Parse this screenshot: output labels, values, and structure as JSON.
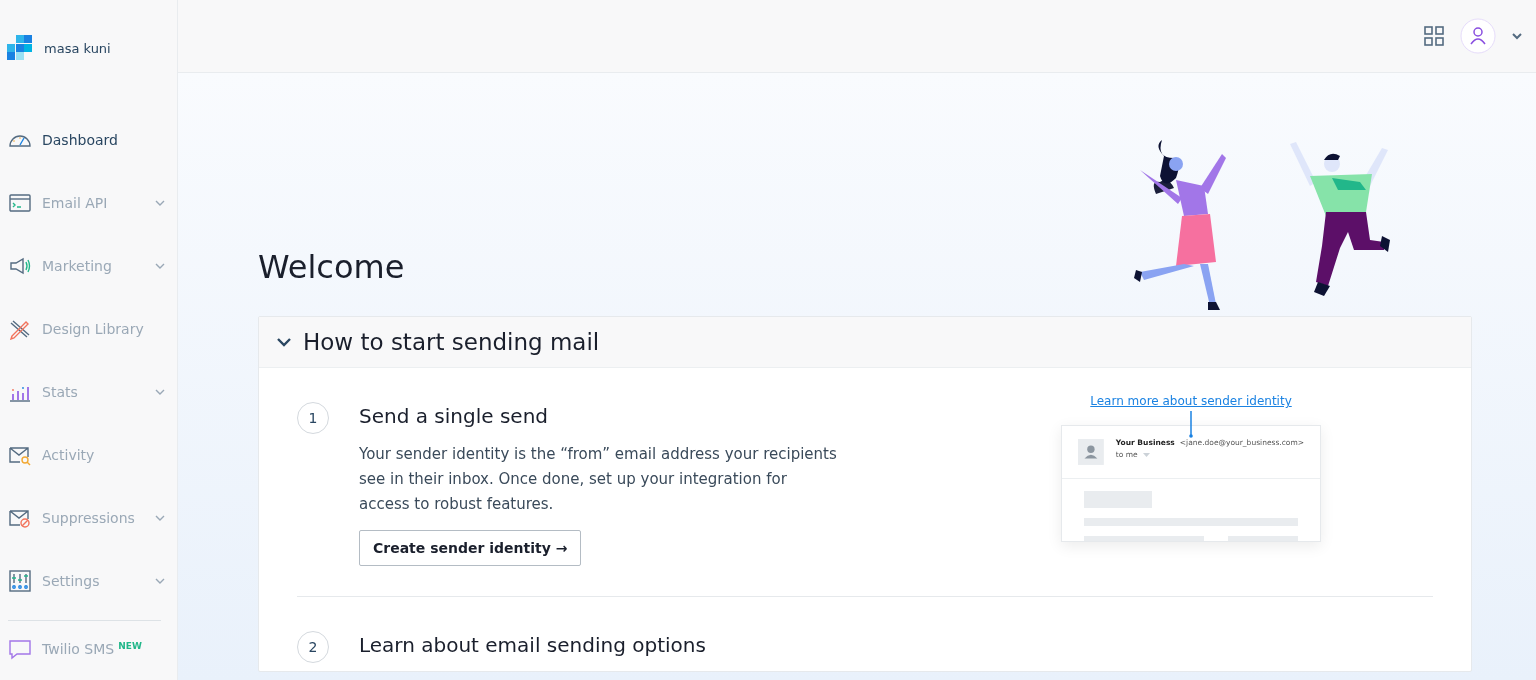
{
  "sidebar": {
    "account": "masa kuni",
    "items": [
      {
        "label": "Dashboard",
        "selected": true,
        "expandable": false
      },
      {
        "label": "Email API",
        "selected": false,
        "expandable": true
      },
      {
        "label": "Marketing",
        "selected": false,
        "expandable": true
      },
      {
        "label": "Design Library",
        "selected": false,
        "expandable": false
      },
      {
        "label": "Stats",
        "selected": false,
        "expandable": true
      },
      {
        "label": "Activity",
        "selected": false,
        "expandable": false
      },
      {
        "label": "Suppressions",
        "selected": false,
        "expandable": true
      },
      {
        "label": "Settings",
        "selected": false,
        "expandable": true
      }
    ],
    "footer_item": {
      "label": "Twilio SMS",
      "badge": "NEW"
    }
  },
  "main": {
    "title": "Welcome",
    "guide": {
      "title": "How to start sending mail",
      "expanded": true,
      "steps": [
        {
          "number": "1",
          "title": "Send a single send",
          "text": "Your sender identity is the “from” email address your recipients see in their inbox. Once done, set up your integration for access to robust features.",
          "button": "Create sender identity →",
          "link": "Learn more about sender identity",
          "preview": {
            "sender_name": "Your Business",
            "sender_email": "<jane.doe@your_business.com>",
            "recipient": "to me"
          }
        },
        {
          "number": "2",
          "title": "Learn about email sending options"
        }
      ]
    }
  }
}
